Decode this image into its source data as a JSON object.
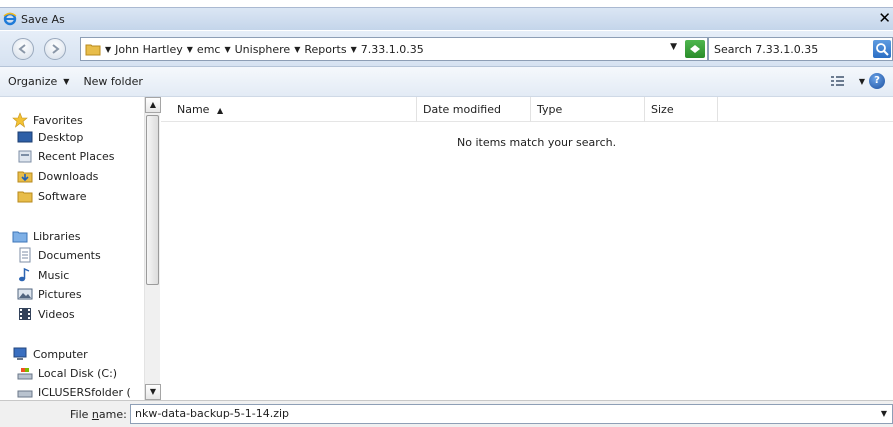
{
  "window": {
    "title": "Save As"
  },
  "address": {
    "crumbs": [
      "John Hartley",
      "emc",
      "Unisphere",
      "Reports",
      "7.33.1.0.35"
    ],
    "search_placeholder": "Search 7.33.1.0.35"
  },
  "toolbar": {
    "organize_label": "Organize",
    "new_folder_label": "New folder"
  },
  "nav": {
    "favorites_label": "Favorites",
    "favorites": [
      "Desktop",
      "Recent Places",
      "Downloads",
      "Software"
    ],
    "libraries_label": "Libraries",
    "libraries": [
      "Documents",
      "Music",
      "Pictures",
      "Videos"
    ],
    "computer_label": "Computer",
    "computer": [
      "Local Disk (C:)",
      "ICLUSERSfolder ("
    ]
  },
  "columns": [
    "Name",
    "Date modified",
    "Type",
    "Size"
  ],
  "empty_message": "No items match your search.",
  "file": {
    "label_prefix": "File ",
    "label_accel": "n",
    "label_suffix": "ame:",
    "value": "nkw-data-backup-5-1-14.zip"
  },
  "colors": {
    "title_bg": "#c4d5ea",
    "accent": "#2b6ec5"
  }
}
